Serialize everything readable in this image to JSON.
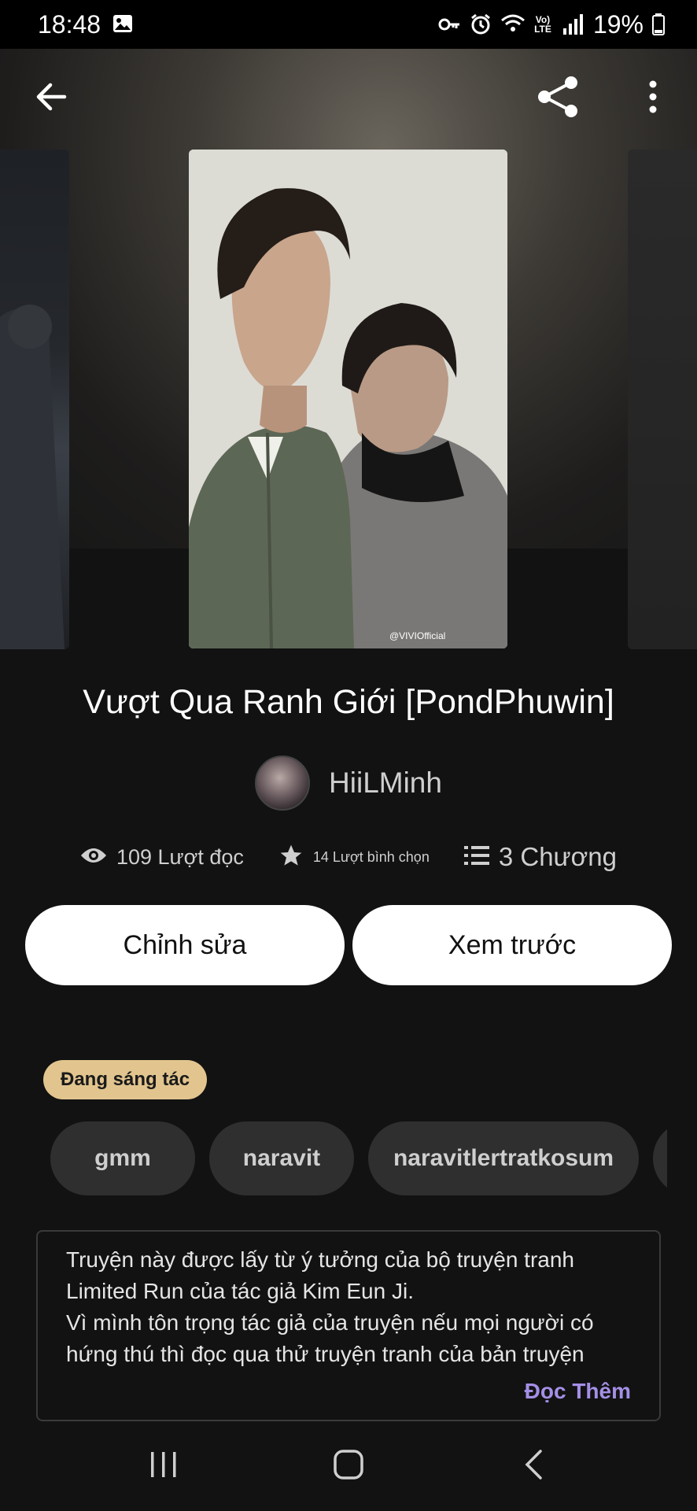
{
  "status_bar": {
    "time": "18:48",
    "battery": "19%",
    "lte_label": "Vo) LTE"
  },
  "toolbar": {
    "back_icon": "arrow-left-icon",
    "share_icon": "share-icon",
    "more_icon": "more-vertical-icon"
  },
  "cover": {
    "watermark": "@VIVIOfficial"
  },
  "story": {
    "title": "Vượt Qua Ranh Giới [PondPhuwin]",
    "author": "HiiLMinh",
    "reads": "109 Lượt đọc",
    "votes": "14 Lượt bình chọn",
    "chapters": "3 Chương"
  },
  "actions": {
    "edit_label": "Chỉnh sửa",
    "preview_label": "Xem trước"
  },
  "status_label": "Đang sáng tác",
  "tags": [
    "gmm",
    "naravit",
    "naravitlertratkosum",
    ""
  ],
  "description": {
    "text": "Truyện này được lấy từ ý tưởng của bộ truyện tranh Limited Run của tác giả Kim Eun Ji.\nVì mình tôn trọng tác giả của truyện nếu mọi người có hứng thú thì đọc qua thử truyện tranh của bản truyện",
    "read_more": "Đọc Thêm"
  },
  "colors": {
    "accent_read_more": "#a48fe6",
    "status_pill": "#e2c58e",
    "background": "#121212"
  }
}
